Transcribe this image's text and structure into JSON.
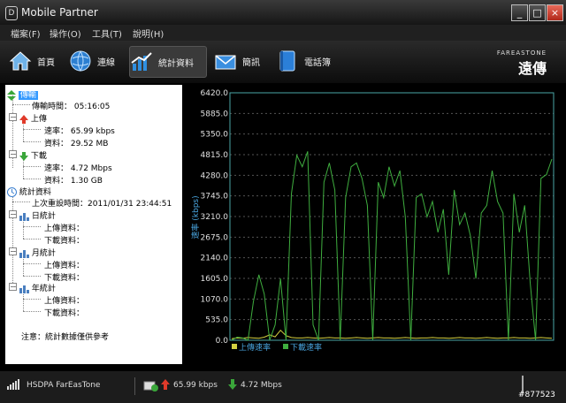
{
  "window": {
    "title": "Mobile Partner",
    "app_icon": "mobile-partner-logo",
    "buttons": [
      "minimize",
      "maximize",
      "close"
    ]
  },
  "menu": [
    "檔案(F)",
    "操作(O)",
    "工具(T)",
    "說明(H)"
  ],
  "toolbar": {
    "items": [
      {
        "label": "首頁",
        "icon": "home-icon"
      },
      {
        "label": "連線",
        "icon": "connect-globe-icon"
      },
      {
        "label": "統計資料",
        "icon": "statistics-chart-icon",
        "active": true
      },
      {
        "label": "簡訊",
        "icon": "sms-envelope-icon"
      },
      {
        "label": "電話簿",
        "icon": "phonebook-icon"
      }
    ],
    "brand_top": "FAREASTONE",
    "brand_main": "遠傳"
  },
  "tree": {
    "transfer": {
      "label": "傳輸",
      "duration_label": "傳輸時間：",
      "duration_value": "05:16:05",
      "upload": {
        "label": "上傳",
        "rate_label": "速率：",
        "rate_value": "65.99 kbps",
        "data_label": "資料：",
        "data_value": "29.52 MB"
      },
      "download": {
        "label": "下載",
        "rate_label": "速率：",
        "rate_value": "4.72 Mbps",
        "data_label": "資料：",
        "data_value": "1.30 GB"
      }
    },
    "stats": {
      "label": "統計資料",
      "reset_label": "上次重設時間：",
      "reset_value": "2011/01/31 23:44:51",
      "daily": {
        "label": "日統計",
        "up": "上傳資料：",
        "down": "下載資料："
      },
      "monthly": {
        "label": "月統計",
        "up": "上傳資料：",
        "down": "下載資料："
      },
      "yearly": {
        "label": "年統計",
        "up": "上傳資料：",
        "down": "下載資料："
      }
    },
    "note": "注意：統計數據僅供參考"
  },
  "chart_data": {
    "type": "line",
    "ylabel": "速率 (kbps)",
    "yticks": [
      "6420.0",
      "5885.0",
      "5350.0",
      "4815.0",
      "4280.0",
      "3745.0",
      "3210.0",
      "2675.0",
      "2140.0",
      "1605.0",
      "1070.0",
      "535.0",
      "0.0"
    ],
    "ylim": [
      0,
      6420
    ],
    "grid": true,
    "legend_position": "bottom-left",
    "series": [
      {
        "name": "上傳速率",
        "color": "#d4d040",
        "values": [
          40,
          60,
          50,
          70,
          60,
          50,
          80,
          140,
          90,
          260,
          120,
          70,
          60,
          60,
          70,
          60,
          50,
          60,
          70,
          60,
          60,
          50,
          60,
          70,
          60,
          50,
          60,
          70,
          60,
          60,
          50,
          60,
          70,
          60,
          50,
          60,
          60,
          70,
          60,
          60,
          50,
          60,
          70,
          60,
          60,
          50,
          60,
          70,
          60,
          50,
          60,
          60,
          70,
          60,
          60,
          50,
          60,
          70,
          60,
          50
        ]
      },
      {
        "name": "下載速率",
        "color": "#3fae3f",
        "values": [
          0,
          80,
          60,
          0,
          1000,
          1700,
          1200,
          0,
          400,
          1600,
          0,
          3800,
          4800,
          4500,
          4900,
          400,
          0,
          4100,
          4600,
          3900,
          0,
          3700,
          4500,
          4600,
          4200,
          3500,
          0,
          4100,
          3700,
          4500,
          4000,
          4400,
          3200,
          0,
          3700,
          3800,
          3200,
          3600,
          2800,
          3400,
          1700,
          3900,
          3000,
          3300,
          2700,
          1600,
          3300,
          3500,
          4400,
          3600,
          3300,
          0,
          3800,
          2800,
          3500,
          1500,
          0,
          4200,
          4300,
          4700
        ]
      }
    ]
  },
  "status": {
    "signal_icon": "signal-bars-icon",
    "network": "HSDPA FarEasTone",
    "upload_icon": "upload-arrow-icon",
    "upload_rate": "65.99 kbps",
    "download_icon": "download-arrow-icon",
    "download_rate": "4.72 Mbps",
    "id_tag": "#877523"
  },
  "colors": {
    "plot_border": "#4aa6a6",
    "grid": "#555555",
    "tick_text": "#e0e0e0",
    "upload": "#d4d040",
    "download": "#3fae3f",
    "tree_selected": "#3399ff"
  }
}
